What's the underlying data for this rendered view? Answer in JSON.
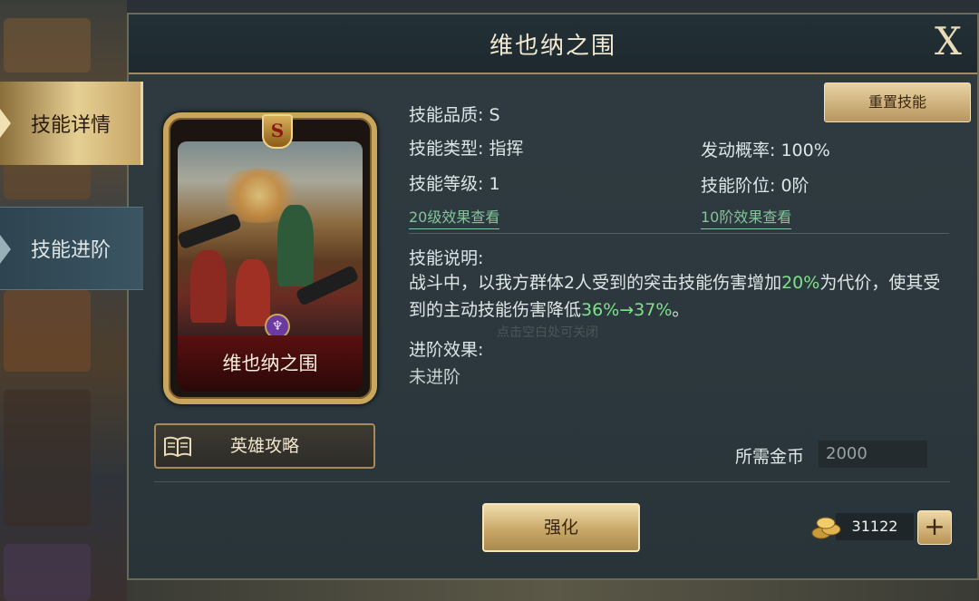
{
  "dialog": {
    "title": "维也纳之围",
    "close_label": "X"
  },
  "tabs": [
    {
      "label": "技能详情",
      "active": true
    },
    {
      "label": "技能进阶",
      "active": false
    }
  ],
  "card": {
    "grade_badge": "S",
    "name": "维也纳之围"
  },
  "strategy_button": {
    "label": "英雄攻略",
    "icon": "book-icon"
  },
  "reset_button": {
    "label": "重置技能"
  },
  "skill": {
    "quality": "技能品质: S",
    "type": "技能类型: 指挥",
    "level": "技能等级: 1",
    "level_link": "20级效果查看",
    "trigger_rate": "发动概率: 100%",
    "rank": "技能阶位: 0阶",
    "rank_link": "10阶效果查看",
    "desc_title": "技能说明:",
    "desc_part1": "战斗中，以我方群体2人受到的突击技能伤害增加",
    "desc_hl1": "20%",
    "desc_part2": "为代价，使其受到的主动技能伤害降低",
    "desc_hl2": "36%→37%",
    "desc_part3": "。",
    "advance_title": "进阶效果:",
    "advance_value": "未进阶"
  },
  "hint": "点击空白处可关闭",
  "cost": {
    "label": "所需金币",
    "value": "2000"
  },
  "enhance_button": {
    "label": "强化"
  },
  "wallet": {
    "coins": "31122",
    "coin_icon": "gold-coins-icon",
    "add_label": "+"
  },
  "colors": {
    "highlight": "#7fe28a",
    "link": "#83c49a",
    "gold_button": "#c9a868"
  }
}
